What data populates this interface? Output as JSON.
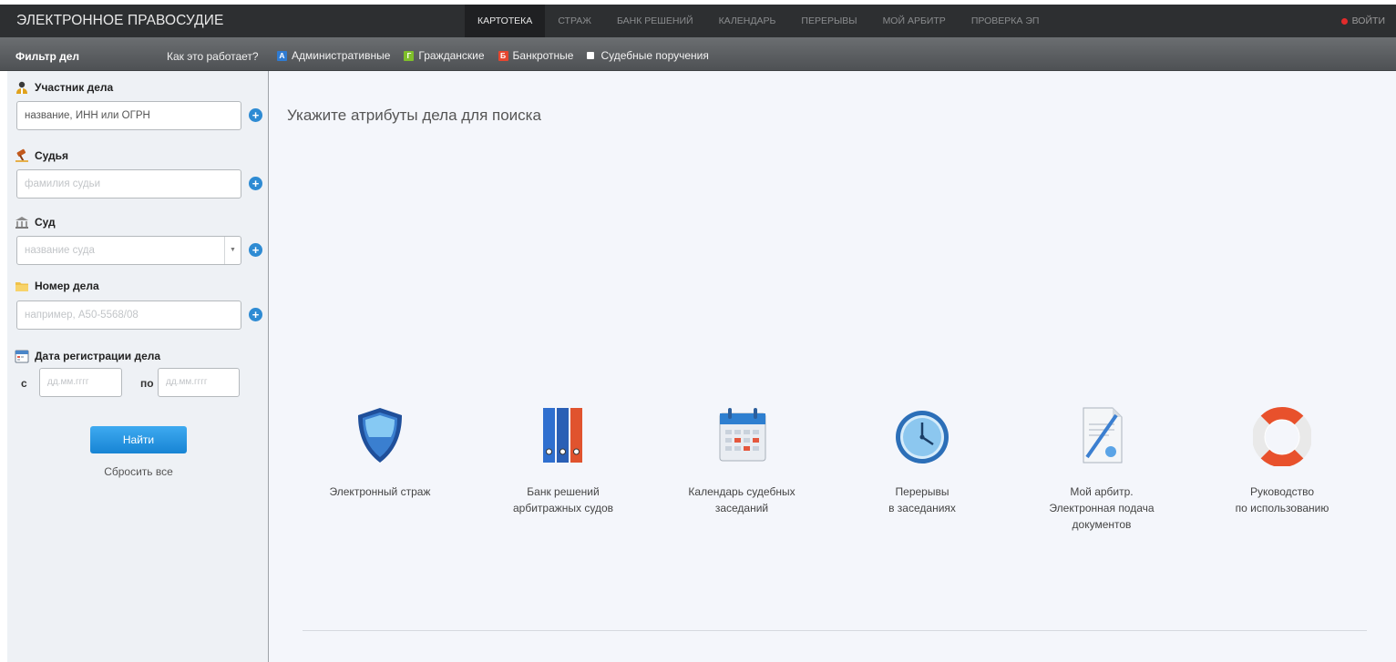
{
  "header": {
    "brand": "ЭЛЕКТРОННОЕ ПРАВОСУДИЕ",
    "nav": [
      {
        "label": "КАРТОТЕКА",
        "active": true
      },
      {
        "label": "СТРАЖ",
        "active": false
      },
      {
        "label": "БАНК РЕШЕНИЙ",
        "active": false
      },
      {
        "label": "КАЛЕНДАРЬ",
        "active": false
      },
      {
        "label": "ПЕРЕРЫВЫ",
        "active": false
      },
      {
        "label": "МОЙ АРБИТР",
        "active": false
      },
      {
        "label": "ПРОВЕРКА ЭП",
        "active": false
      }
    ],
    "login": "ВОЙТИ",
    "login_dot_color": "#e12b2b"
  },
  "filterbar": {
    "title": "Фильтр дел",
    "howto": "Как это работает?",
    "categories": [
      {
        "badge": "А",
        "label": "Административные",
        "color": "#2f7bd1"
      },
      {
        "badge": "Г",
        "label": "Гражданские",
        "color": "#7fbf2a"
      },
      {
        "badge": "Б",
        "label": "Банкротные",
        "color": "#e5462f"
      },
      {
        "badge": "",
        "label": "Судебные поручения",
        "color": "#ffffff"
      }
    ]
  },
  "sidebar": {
    "participant": {
      "label": "Участник дела",
      "value": "название, ИНН или ОГРН",
      "icon": "person-icon"
    },
    "judge": {
      "label": "Судья",
      "placeholder": "фамилия судьи",
      "icon": "gavel-icon"
    },
    "court": {
      "label": "Суд",
      "placeholder": "название суда",
      "icon": "courthouse-icon"
    },
    "case_number": {
      "label": "Номер дела",
      "placeholder": "например, А50-5568/08",
      "icon": "folder-icon"
    },
    "reg_date": {
      "label": "Дата регистрации дела",
      "icon": "calendar-icon",
      "from_label": "с",
      "to_label": "по",
      "from_placeholder": "дд.мм.гггг",
      "to_placeholder": "дд.мм.гггг"
    },
    "find_button": "Найти",
    "reset_link": "Сбросить все",
    "accent_color": "#2e8bd3"
  },
  "main": {
    "prompt": "Укажите атрибуты дела для поиска",
    "tiles": [
      {
        "label": "Электронный страж",
        "icon": "shield-icon"
      },
      {
        "label": "Банк решений\nарбитражных судов",
        "icon": "binders-icon"
      },
      {
        "label": "Календарь судебных\nзаседаний",
        "icon": "calendar-icon"
      },
      {
        "label": "Перерывы\nв заседаниях",
        "icon": "clock-icon"
      },
      {
        "label": "Мой арбитр.\nЭлектронная подача\nдокументов",
        "icon": "document-icon"
      },
      {
        "label": "Руководство\nпо использованию",
        "icon": "lifebuoy-icon"
      }
    ]
  }
}
